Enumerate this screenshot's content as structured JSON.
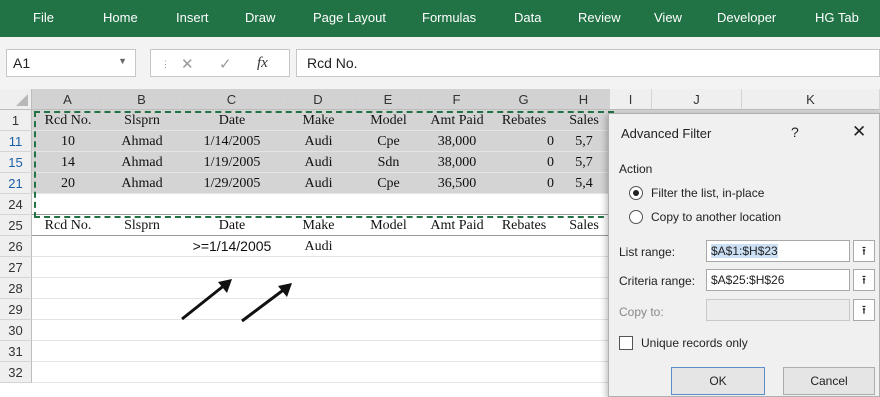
{
  "ribbon": {
    "tabs": [
      "File",
      "Home",
      "Insert",
      "Draw",
      "Page Layout",
      "Formulas",
      "Data",
      "Review",
      "View",
      "Developer",
      "HG Tab"
    ],
    "color": "#217346"
  },
  "formula_bar": {
    "name_box": "A1",
    "fx": "fx",
    "formula": "Rcd No."
  },
  "grid": {
    "columns": [
      "A",
      "B",
      "C",
      "D",
      "E",
      "F",
      "G",
      "H",
      "I",
      "J",
      "K"
    ],
    "rows": [
      {
        "num": "1",
        "cells": [
          "Rcd No.",
          "Slsprn",
          "Date",
          "Make",
          "Model",
          "Amt Paid",
          "Rebates",
          "Sales"
        ]
      },
      {
        "num": "11",
        "cells": [
          "10",
          "Ahmad",
          "1/14/2005",
          "Audi",
          "Cpe",
          "38,000",
          "0",
          "5,7"
        ]
      },
      {
        "num": "15",
        "cells": [
          "14",
          "Ahmad",
          "1/19/2005",
          "Audi",
          "Sdn",
          "38,000",
          "0",
          "5,7"
        ]
      },
      {
        "num": "21",
        "cells": [
          "20",
          "Ahmad",
          "1/29/2005",
          "Audi",
          "Cpe",
          "36,500",
          "0",
          "5,4"
        ]
      },
      {
        "num": "24",
        "cells": [
          "",
          "",
          "",
          "",
          "",
          "",
          "",
          ""
        ]
      },
      {
        "num": "25",
        "cells": [
          "Rcd No.",
          "Slsprn",
          "Date",
          "Make",
          "Model",
          "Amt Paid",
          "Rebates",
          "Sales"
        ]
      },
      {
        "num": "26",
        "cells": [
          "",
          "",
          ">=1/14/2005",
          "Audi",
          "",
          "",
          "",
          ""
        ]
      },
      {
        "num": "27",
        "cells": [
          "",
          "",
          "",
          "",
          "",
          "",
          "",
          ""
        ]
      },
      {
        "num": "28",
        "cells": [
          "",
          "",
          "",
          "",
          "",
          "",
          "",
          ""
        ]
      },
      {
        "num": "29",
        "cells": [
          "",
          "",
          "",
          "",
          "",
          "",
          "",
          ""
        ]
      },
      {
        "num": "30",
        "cells": [
          "",
          "",
          "",
          "",
          "",
          "",
          "",
          ""
        ]
      },
      {
        "num": "31",
        "cells": [
          "",
          "",
          "",
          "",
          "",
          "",
          "",
          ""
        ]
      },
      {
        "num": "32",
        "cells": [
          "",
          "",
          "",
          "",
          "",
          "",
          "",
          ""
        ]
      }
    ]
  },
  "dialog": {
    "title": "Advanced Filter",
    "help": "?",
    "close": "✕",
    "action": "Action",
    "opt1": "Filter the list, in-place",
    "opt2": "Copy to another location",
    "list_label": "List range:",
    "list_value": "$A$1:$H$23",
    "criteria_label": "Criteria range:",
    "criteria_value": "$A$25:$H$26",
    "copy_label": "Copy to:",
    "copy_value": "",
    "unique": "Unique records only",
    "ok": "OK",
    "cancel": "Cancel",
    "range_icon": "⭱"
  }
}
